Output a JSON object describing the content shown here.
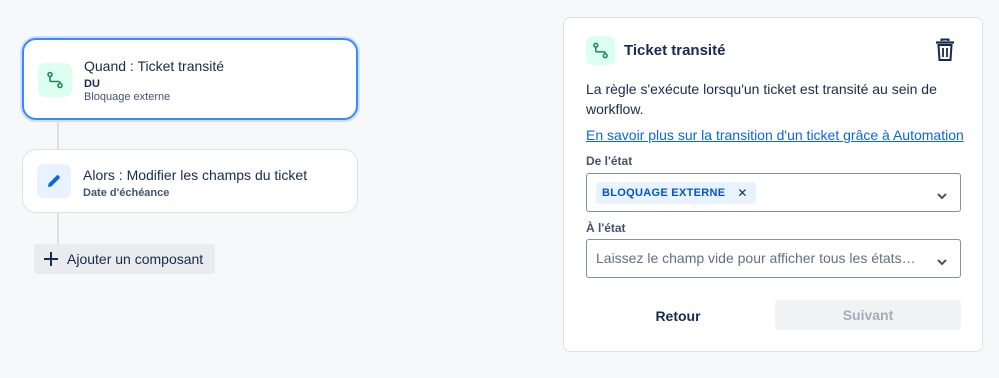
{
  "flow": {
    "trigger": {
      "icon": "transition-icon",
      "title": "Quand : Ticket transité",
      "from_status": "DU",
      "status_value": "Bloquage externe"
    },
    "action": {
      "icon": "pencil-icon",
      "title": "Alors : Modifier les champs du ticket",
      "field": "Date d'échéance"
    },
    "add_component_label": "Ajouter un composant"
  },
  "panel": {
    "icon": "transition-icon",
    "title": "Ticket transité",
    "description": "La règle s'exécute lorsqu'un ticket est transité au sein de workflow.",
    "learn_more_link": "En savoir plus sur la transition d'un ticket grâce à Automation",
    "from_label": "De l'état",
    "from_tag": "BLOQUAGE EXTERNE",
    "to_label": "À l'état",
    "to_placeholder": "Laissez le champ vide pour afficher tous les états…",
    "back_label": "Retour",
    "next_label": "Suivant"
  },
  "colors": {
    "accent": "#388bff",
    "link": "#0c66e4",
    "trigger_icon_bg": "#dcfff1",
    "trigger_icon": "#1f845a",
    "action_icon_bg": "#e9f2ff",
    "action_icon": "#0c66e4"
  }
}
